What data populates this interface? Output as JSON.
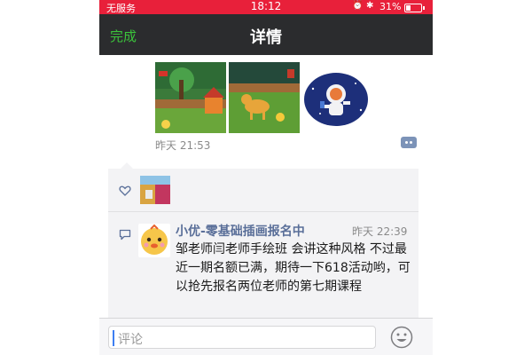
{
  "status_bar": {
    "carrier": "无服务",
    "time": "18:12",
    "battery": "31%",
    "battery_level": 0.31
  },
  "nav": {
    "back_label": "完成",
    "title": "详情"
  },
  "post": {
    "time": "昨天 21:53"
  },
  "comments": [
    {
      "author": "小优-零基础插画报名中",
      "time": "昨天 22:39",
      "text": "邹老师闫老师手绘班 会讲这种风格 不过最近一期名额已满，期待一下618活动哟，可以抢先报名两位老师的第七期课程"
    }
  ],
  "input": {
    "placeholder": "评论"
  },
  "icons": {
    "alarm": "alarm-icon",
    "bluetooth": "bluetooth-icon",
    "battery": "battery-icon",
    "like": "heart-icon",
    "comment": "comment-icon",
    "more": "comment-dots-icon",
    "emoji": "emoji-icon"
  },
  "colors": {
    "status_bar": "#e8203a",
    "nav_bar": "#2b2c2e",
    "nav_action": "#3bc33b",
    "author_link": "#5a6f99"
  }
}
